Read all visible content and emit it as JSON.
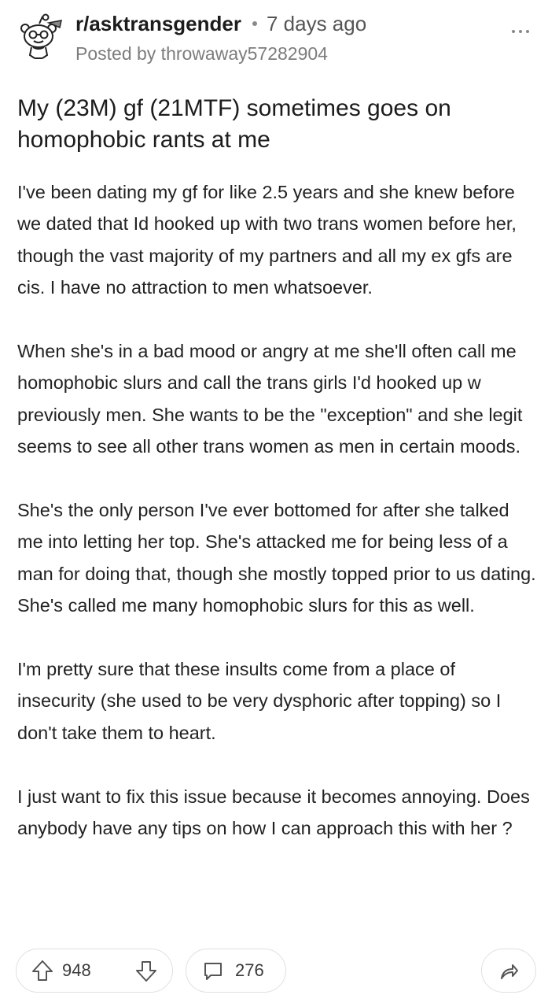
{
  "header": {
    "subreddit": "r/asktransgender",
    "time_ago": "7 days ago",
    "posted_by": "Posted by throwaway57282904"
  },
  "post": {
    "title": "My (23M) gf (21MTF) sometimes goes on homophobic rants at me",
    "paragraphs": [
      "I've been dating my gf for like 2.5 years and she knew before we dated that Id hooked up with two trans women before her, though the vast majority of my partners and all my ex gfs are cis. I have no attraction to men whatsoever.",
      "When she's in a bad mood or angry at me she'll often call me homophobic slurs and call the trans girls I'd hooked up w previously men. She wants to be the \"exception\" and she legit seems to see all other trans women as men in certain moods.",
      "She's the only person I've ever bottomed for after she talked me into letting her top. She's attacked me for being less of a man for doing that, though she mostly topped prior to us dating. She's called me many homophobic slurs for this as well.",
      "I'm pretty sure that these insults come from a place of insecurity (she used to be very dysphoric after topping) so I don't take them to heart.",
      "I just want to fix this issue because it becomes annoying. Does anybody have any tips on how I can approach this with her ?"
    ]
  },
  "footer": {
    "upvotes": "948",
    "comments": "276"
  },
  "icons": {
    "avatar": "snoo-avatar-icon",
    "more": "more-options-icon",
    "upvote": "upvote-arrow-icon",
    "downvote": "downvote-arrow-icon",
    "comment": "comment-bubble-icon",
    "share": "share-arrow-icon"
  },
  "colors": {
    "text": "#1c1c1c",
    "meta": "#7c7c7c",
    "border": "#e0e0e0"
  }
}
